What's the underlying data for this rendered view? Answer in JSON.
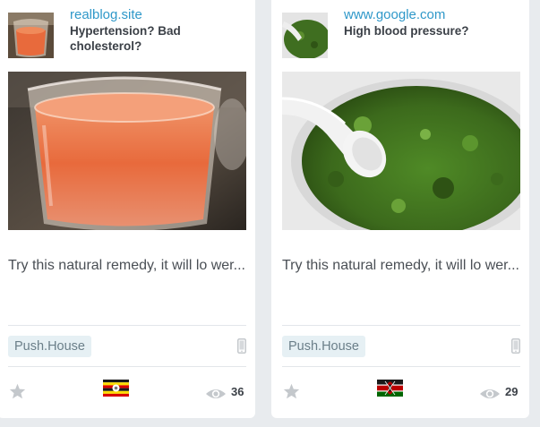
{
  "cards": [
    {
      "source": "realblog.site",
      "title": "Hypertension? Bad cholesterol?",
      "description": "Try this natural remedy, it will lo wer...",
      "network": "Push.House",
      "device": "mobile-phone-icon",
      "country_flag": "uganda-flag",
      "views": "36",
      "image": "glass-of-orange-juice"
    },
    {
      "source": "www.google.com",
      "title": "High blood pressure?",
      "description": "Try this natural remedy, it will lo wer...",
      "network": "Push.House",
      "device": "mobile-phone-icon",
      "country_flag": "kenya-flag",
      "views": "29",
      "image": "green-herb-paste-with-spoon"
    }
  ],
  "colors": {
    "source_link": "#2f98c9",
    "title_text": "#3b4047",
    "badge_bg": "#e6f0f4",
    "badge_text": "#6b7f89",
    "page_bg": "#e8ebee",
    "icon_gray": "#c4c8cc"
  }
}
